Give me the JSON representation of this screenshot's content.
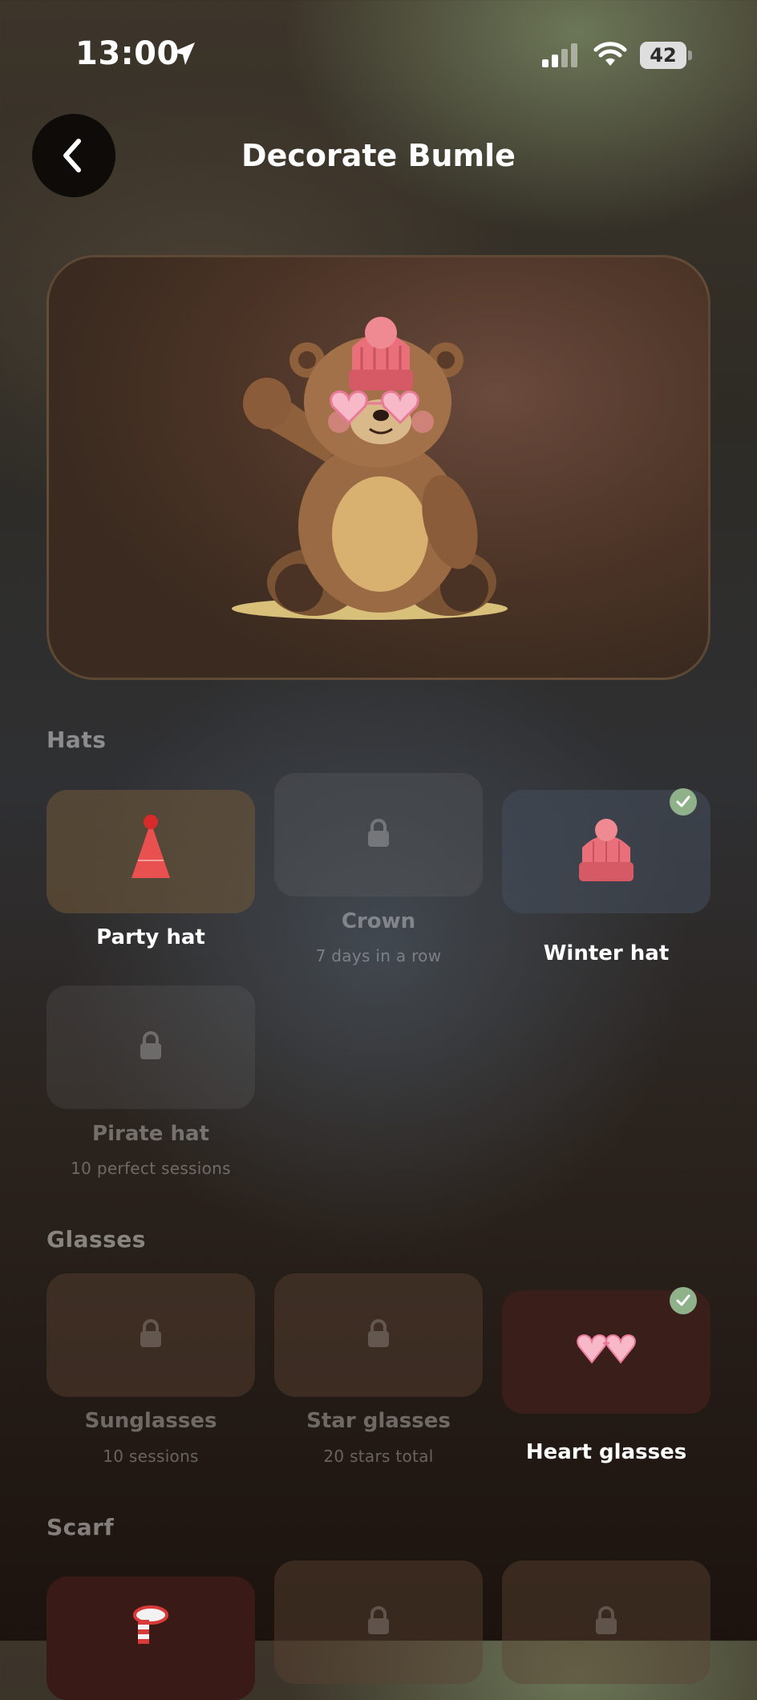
{
  "status_bar": {
    "time": "13:00",
    "battery": "42"
  },
  "header": {
    "title": "Decorate Bumle"
  },
  "sections": {
    "hats": {
      "label": "Hats",
      "items": [
        {
          "name": "Party hat",
          "requirement": "",
          "state": "unlocked"
        },
        {
          "name": "Crown",
          "requirement": "7 days in a row",
          "state": "locked"
        },
        {
          "name": "Winter hat",
          "requirement": "",
          "state": "selected"
        },
        {
          "name": "Pirate hat",
          "requirement": "10 perfect sessions",
          "state": "locked"
        }
      ]
    },
    "glasses": {
      "label": "Glasses",
      "items": [
        {
          "name": "Sunglasses",
          "requirement": "10 sessions",
          "state": "locked"
        },
        {
          "name": "Star glasses",
          "requirement": "20 stars total",
          "state": "locked"
        },
        {
          "name": "Heart glasses",
          "requirement": "",
          "state": "selected"
        }
      ]
    },
    "scarf": {
      "label": "Scarf",
      "items": [
        {
          "state": "unlocked"
        },
        {
          "state": "locked"
        },
        {
          "state": "locked"
        }
      ]
    }
  },
  "colors": {
    "selected_check": "#8fb28a",
    "party_tile": "#5a4a36",
    "winter_tile": "#3a3d44",
    "heart_tile": "#3a1e1a",
    "scarf_tile": "#3a1a16"
  },
  "icons": [
    "location-arrow-icon",
    "signal-icon",
    "wifi-icon",
    "battery-icon",
    "chevron-left-icon",
    "lock-icon",
    "checkmark-icon",
    "party-hat-icon",
    "winter-hat-icon",
    "heart-glasses-icon",
    "scarf-icon"
  ]
}
